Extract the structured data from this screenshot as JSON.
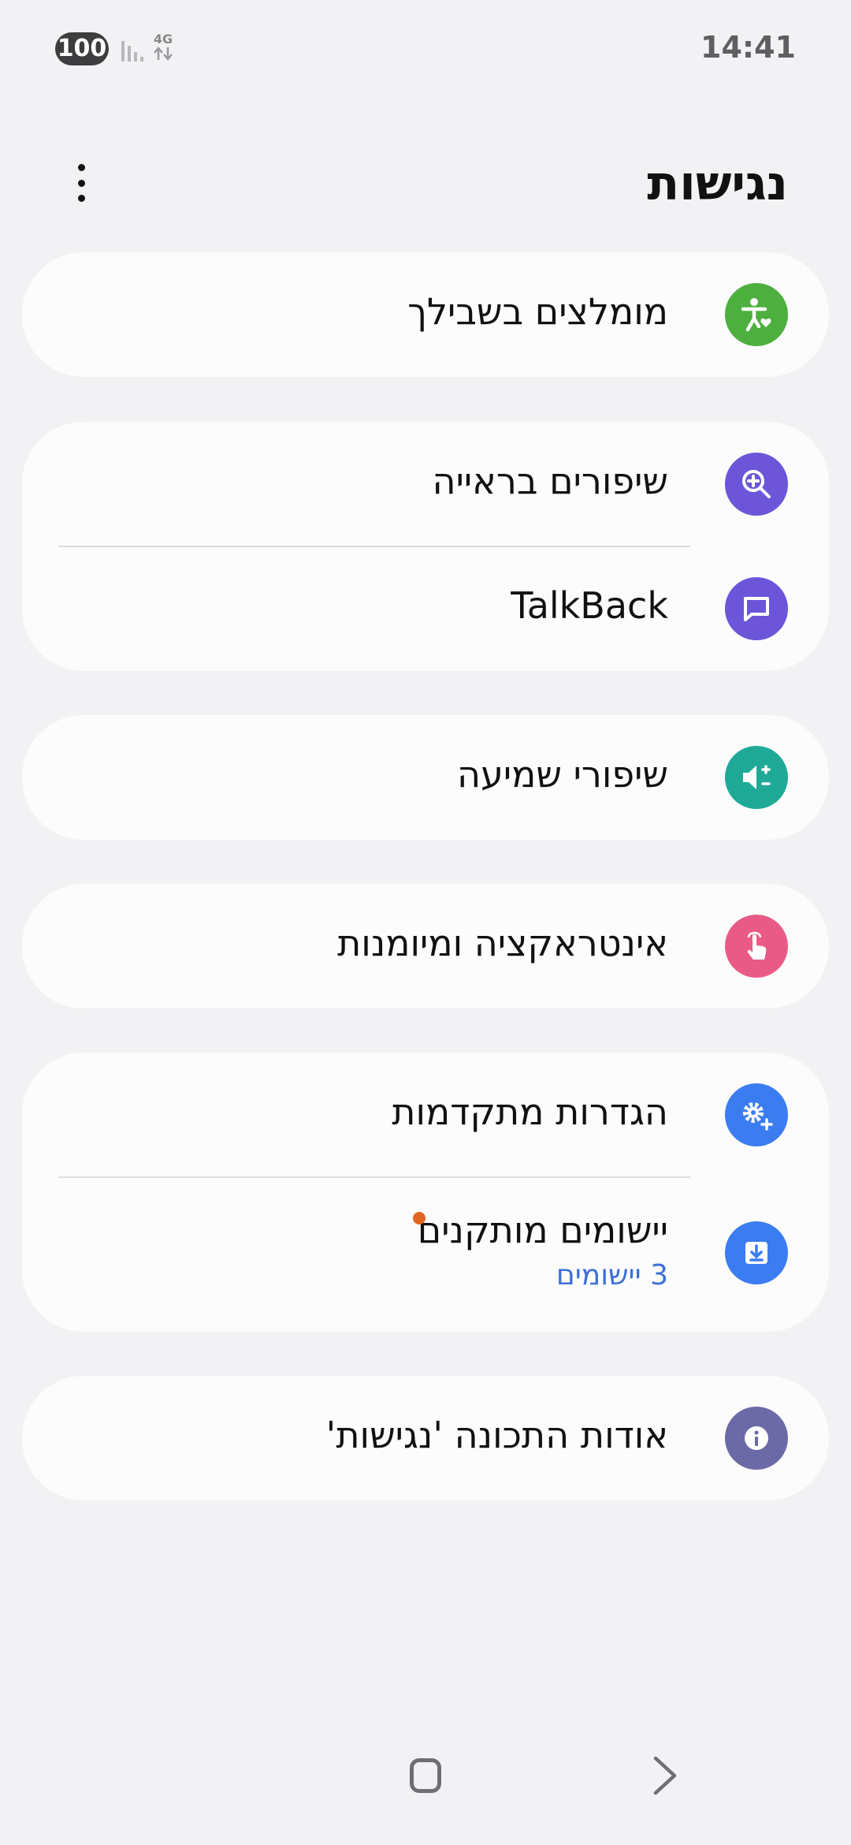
{
  "status_bar": {
    "battery": "100",
    "network": "4G",
    "time": "14:41"
  },
  "header": {
    "title": "נגישות",
    "more_icon": "more-vert-icon"
  },
  "items": {
    "recommended": {
      "label": "מומלצים בשבילך",
      "icon": "accessibility-heart-icon",
      "color": "#4caf3e"
    },
    "vision": {
      "label": "שיפורים בראייה",
      "icon": "zoom-in-icon",
      "color": "#6c55d9"
    },
    "talkback": {
      "label": "TalkBack",
      "icon": "chat-bubble-icon",
      "color": "#6c55d9"
    },
    "hearing": {
      "label": "שיפורי שמיעה",
      "icon": "volume-plus-icon",
      "color": "#1faa98"
    },
    "interaction": {
      "label": "אינטראקציה ומיומנות",
      "icon": "touch-hand-icon",
      "color": "#e95b86"
    },
    "advanced": {
      "label": "הגדרות מתקדמות",
      "icon": "gear-plus-icon",
      "color": "#3b7cf0"
    },
    "installed_apps": {
      "label": "יישומים מותקנים",
      "sublabel": "3 יישומים",
      "icon": "download-box-icon",
      "color": "#3b7cf0",
      "badge_color": "#e2651f"
    },
    "about": {
      "label": "אודות התכונה 'נגישות'",
      "icon": "info-icon",
      "color": "#6b6aa6"
    }
  },
  "nav_bar": {
    "home_icon": "home-square-icon",
    "back_icon": "chevron-back-icon"
  }
}
